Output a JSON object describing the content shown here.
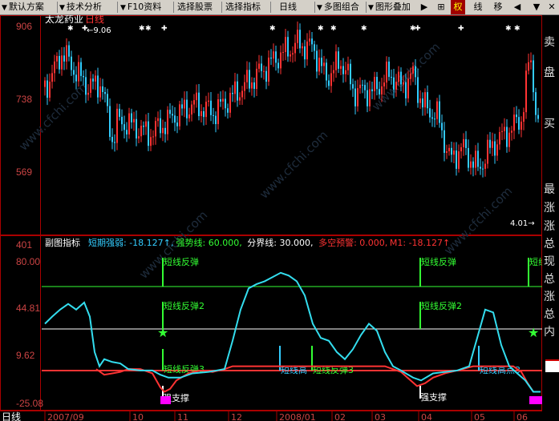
{
  "toolbar": {
    "items": [
      {
        "label": "默认方案"
      },
      {
        "label": "技术分析"
      },
      {
        "label": "F10资料"
      },
      {
        "label": "选择股票"
      },
      {
        "label": "选择指标"
      },
      {
        "label": "日线"
      },
      {
        "label": "多图组合"
      },
      {
        "label": "图形叠加"
      }
    ],
    "buttons": [
      "▶",
      "⊞",
      "权",
      "线",
      "移",
      "◀",
      "▼"
    ]
  },
  "main_chart": {
    "stock_name": "太龙药业",
    "period": "日线",
    "high_annotation": "←9.06",
    "y_ticks": [
      "906",
      "738",
      "569",
      "401"
    ],
    "y_values": [
      9.06,
      7.38,
      5.69,
      4.01
    ],
    "low_annotation": "4.01→",
    "watermarks": [
      "www.cfchi.com",
      "www.cfchi.com",
      "www.cfchi.com",
      "www.cfchi.com",
      "www.cfchi.com"
    ]
  },
  "sub_chart": {
    "title": "副图指标",
    "legend": [
      {
        "text": "短期强弱: -18.127↑,",
        "color": "#33ccff"
      },
      {
        "text": "强势线: 60.000,",
        "color": "#33ff33"
      },
      {
        "text": "分界线: 30.000,",
        "color": "#ffffff"
      },
      {
        "text": "多空预警: 0.000,",
        "color": "#ff3333"
      },
      {
        "text": "M1: -18.127↑",
        "color": "#ff3333"
      }
    ],
    "y_ticks": [
      "80.00",
      "44.81",
      "9.62",
      "-25.08"
    ],
    "labels": {
      "rebound": "短线反弹",
      "rebound2": "短线反弹2",
      "rebound3": "短线反弹3",
      "high": "短线高",
      "high3": "短线高点3",
      "support": "强支撑"
    }
  },
  "x_axis": {
    "period_label": "日线",
    "dates": [
      "2007/09",
      "10",
      "11",
      "12",
      "2008/01",
      "02",
      "03",
      "04",
      "05",
      "06"
    ]
  },
  "right_panel": {
    "labels": [
      "卖",
      "盘",
      "买",
      "最",
      "涨",
      "涨",
      "总",
      "现",
      "总",
      "涨",
      "总",
      "内"
    ]
  },
  "colors": {
    "up": "#ff3333",
    "down": "#33ccff",
    "axis": "#aa0000",
    "strong_line": "#33ff33",
    "divider": "#ffffff",
    "warning": "#ff3333"
  }
}
